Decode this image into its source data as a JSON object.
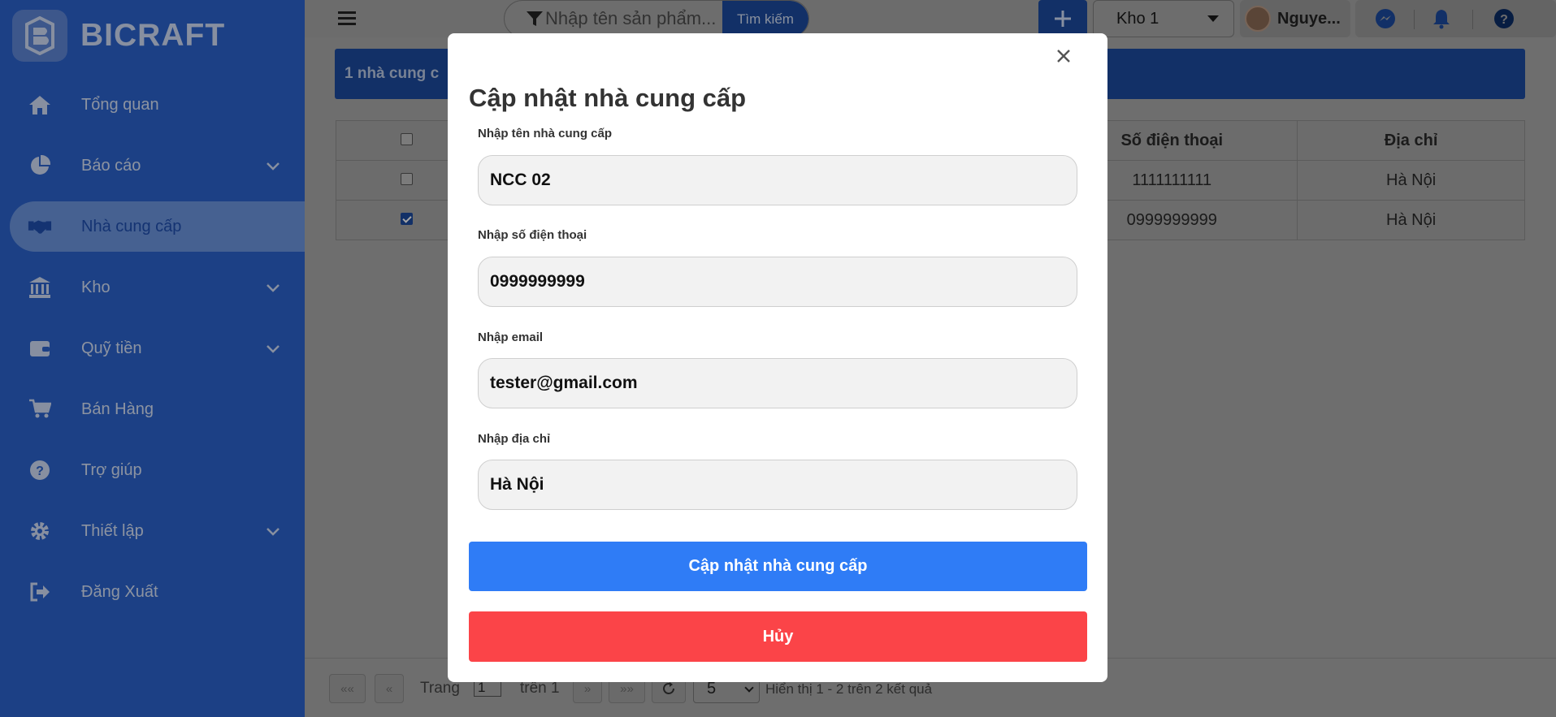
{
  "sidebar": {
    "brand": "BICRAFT",
    "items": [
      {
        "label": "Tổng quan",
        "icon": "home-icon"
      },
      {
        "label": "Báo cáo",
        "icon": "pie-chart-icon"
      },
      {
        "label": "Nhà cung cấp",
        "icon": "handshake-icon"
      },
      {
        "label": "Kho",
        "icon": "bank-icon"
      },
      {
        "label": "Quỹ tiền",
        "icon": "wallet-icon"
      },
      {
        "label": "Bán Hàng",
        "icon": "cart-icon"
      },
      {
        "label": "Trợ giúp",
        "icon": "help-icon"
      },
      {
        "label": "Thiết lập",
        "icon": "gear-icon"
      },
      {
        "label": "Đăng Xuất",
        "icon": "logout-icon"
      }
    ]
  },
  "topbar": {
    "search_placeholder": "Nhập tên sản phẩm...",
    "search_button": "Tìm kiếm",
    "add_button": "+",
    "store_selected": "Kho 1",
    "user_name": "Nguye..."
  },
  "main": {
    "banner_text": "1 nhà cung c",
    "table": {
      "headers": [
        "",
        "Số điện thoại",
        "Địa chỉ"
      ],
      "rows": [
        {
          "checked": false,
          "phone": "1111111111",
          "address": "Hà Nội"
        },
        {
          "checked": true,
          "phone": "0999999999",
          "address": "Hà Nội"
        }
      ]
    },
    "pagination": {
      "first": "««",
      "prev": "«",
      "page_label": "Trang",
      "page_value": "1",
      "of_label": "trên 1",
      "next": "»",
      "last": "»»",
      "page_size": "5",
      "summary": "Hiển thị 1 - 2 trên 2 kết quả"
    }
  },
  "modal": {
    "title": "Cập nhật nhà cung cấp",
    "close": "×",
    "fields": {
      "name": {
        "label": "Nhập tên nhà cung cấp",
        "value": "NCC 02"
      },
      "phone": {
        "label": "Nhập số điện thoại",
        "value": "0999999999"
      },
      "email": {
        "label": "Nhập email",
        "value": "tester@gmail.com"
      },
      "address": {
        "label": "Nhập địa chỉ",
        "value": "Hà Nội"
      }
    },
    "submit_label": "Cập nhật nhà cung cấp",
    "cancel_label": "Hủy"
  },
  "colors": {
    "sidebar": "#2b63cc",
    "primary": "#2f7cf6",
    "danger": "#fb4448"
  }
}
